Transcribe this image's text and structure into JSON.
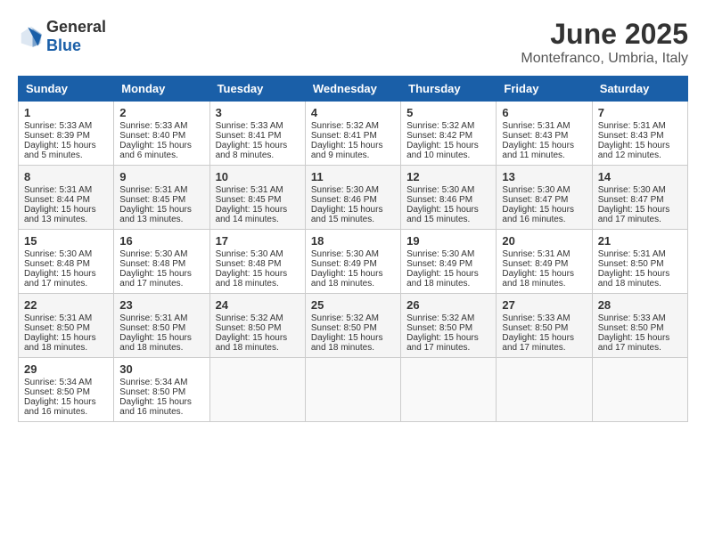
{
  "header": {
    "logo_general": "General",
    "logo_blue": "Blue",
    "month": "June 2025",
    "location": "Montefranco, Umbria, Italy"
  },
  "days_of_week": [
    "Sunday",
    "Monday",
    "Tuesday",
    "Wednesday",
    "Thursday",
    "Friday",
    "Saturday"
  ],
  "weeks": [
    [
      {
        "day": "1",
        "sunrise": "5:33 AM",
        "sunset": "8:39 PM",
        "daylight": "15 hours and 5 minutes."
      },
      {
        "day": "2",
        "sunrise": "5:33 AM",
        "sunset": "8:40 PM",
        "daylight": "15 hours and 6 minutes."
      },
      {
        "day": "3",
        "sunrise": "5:33 AM",
        "sunset": "8:41 PM",
        "daylight": "15 hours and 8 minutes."
      },
      {
        "day": "4",
        "sunrise": "5:32 AM",
        "sunset": "8:41 PM",
        "daylight": "15 hours and 9 minutes."
      },
      {
        "day": "5",
        "sunrise": "5:32 AM",
        "sunset": "8:42 PM",
        "daylight": "15 hours and 10 minutes."
      },
      {
        "day": "6",
        "sunrise": "5:31 AM",
        "sunset": "8:43 PM",
        "daylight": "15 hours and 11 minutes."
      },
      {
        "day": "7",
        "sunrise": "5:31 AM",
        "sunset": "8:43 PM",
        "daylight": "15 hours and 12 minutes."
      }
    ],
    [
      {
        "day": "8",
        "sunrise": "5:31 AM",
        "sunset": "8:44 PM",
        "daylight": "15 hours and 13 minutes."
      },
      {
        "day": "9",
        "sunrise": "5:31 AM",
        "sunset": "8:45 PM",
        "daylight": "15 hours and 13 minutes."
      },
      {
        "day": "10",
        "sunrise": "5:31 AM",
        "sunset": "8:45 PM",
        "daylight": "15 hours and 14 minutes."
      },
      {
        "day": "11",
        "sunrise": "5:30 AM",
        "sunset": "8:46 PM",
        "daylight": "15 hours and 15 minutes."
      },
      {
        "day": "12",
        "sunrise": "5:30 AM",
        "sunset": "8:46 PM",
        "daylight": "15 hours and 15 minutes."
      },
      {
        "day": "13",
        "sunrise": "5:30 AM",
        "sunset": "8:47 PM",
        "daylight": "15 hours and 16 minutes."
      },
      {
        "day": "14",
        "sunrise": "5:30 AM",
        "sunset": "8:47 PM",
        "daylight": "15 hours and 17 minutes."
      }
    ],
    [
      {
        "day": "15",
        "sunrise": "5:30 AM",
        "sunset": "8:48 PM",
        "daylight": "15 hours and 17 minutes."
      },
      {
        "day": "16",
        "sunrise": "5:30 AM",
        "sunset": "8:48 PM",
        "daylight": "15 hours and 17 minutes."
      },
      {
        "day": "17",
        "sunrise": "5:30 AM",
        "sunset": "8:48 PM",
        "daylight": "15 hours and 18 minutes."
      },
      {
        "day": "18",
        "sunrise": "5:30 AM",
        "sunset": "8:49 PM",
        "daylight": "15 hours and 18 minutes."
      },
      {
        "day": "19",
        "sunrise": "5:30 AM",
        "sunset": "8:49 PM",
        "daylight": "15 hours and 18 minutes."
      },
      {
        "day": "20",
        "sunrise": "5:31 AM",
        "sunset": "8:49 PM",
        "daylight": "15 hours and 18 minutes."
      },
      {
        "day": "21",
        "sunrise": "5:31 AM",
        "sunset": "8:50 PM",
        "daylight": "15 hours and 18 minutes."
      }
    ],
    [
      {
        "day": "22",
        "sunrise": "5:31 AM",
        "sunset": "8:50 PM",
        "daylight": "15 hours and 18 minutes."
      },
      {
        "day": "23",
        "sunrise": "5:31 AM",
        "sunset": "8:50 PM",
        "daylight": "15 hours and 18 minutes."
      },
      {
        "day": "24",
        "sunrise": "5:32 AM",
        "sunset": "8:50 PM",
        "daylight": "15 hours and 18 minutes."
      },
      {
        "day": "25",
        "sunrise": "5:32 AM",
        "sunset": "8:50 PM",
        "daylight": "15 hours and 18 minutes."
      },
      {
        "day": "26",
        "sunrise": "5:32 AM",
        "sunset": "8:50 PM",
        "daylight": "15 hours and 17 minutes."
      },
      {
        "day": "27",
        "sunrise": "5:33 AM",
        "sunset": "8:50 PM",
        "daylight": "15 hours and 17 minutes."
      },
      {
        "day": "28",
        "sunrise": "5:33 AM",
        "sunset": "8:50 PM",
        "daylight": "15 hours and 17 minutes."
      }
    ],
    [
      {
        "day": "29",
        "sunrise": "5:34 AM",
        "sunset": "8:50 PM",
        "daylight": "15 hours and 16 minutes."
      },
      {
        "day": "30",
        "sunrise": "5:34 AM",
        "sunset": "8:50 PM",
        "daylight": "15 hours and 16 minutes."
      },
      null,
      null,
      null,
      null,
      null
    ]
  ],
  "labels": {
    "sunrise": "Sunrise:",
    "sunset": "Sunset:",
    "daylight": "Daylight:"
  }
}
